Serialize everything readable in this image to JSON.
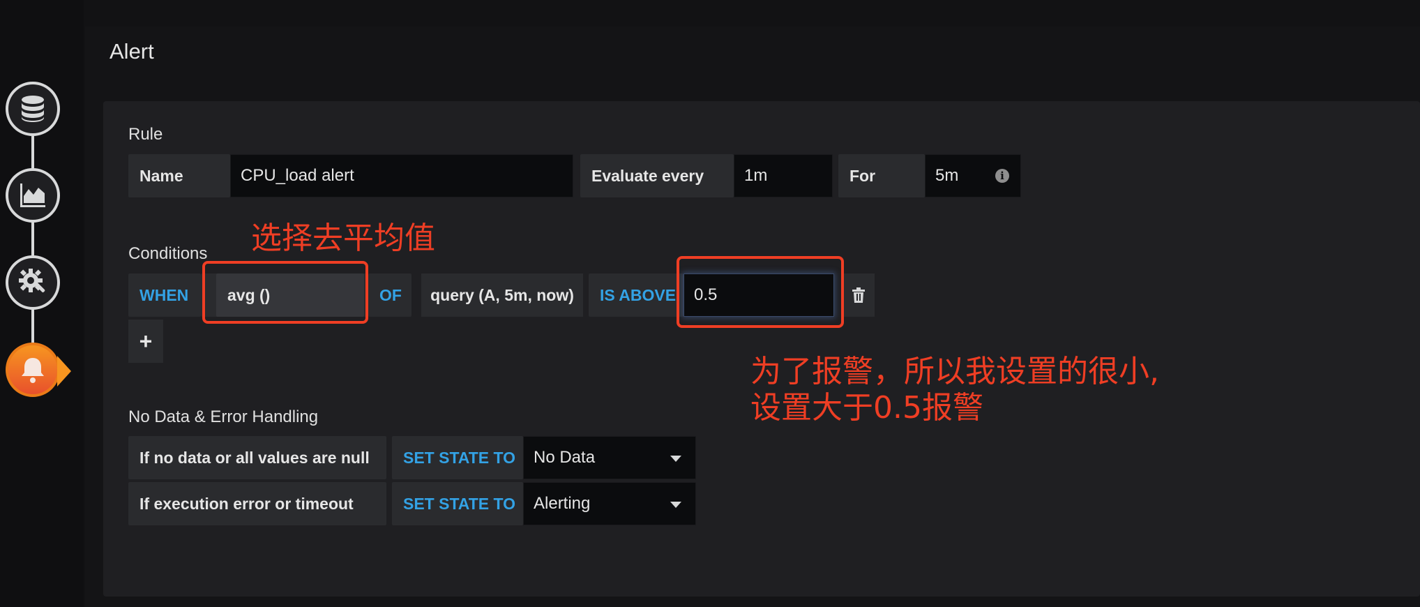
{
  "panel": {
    "title": "Alert"
  },
  "rule": {
    "section_title": "Rule",
    "name_label": "Name",
    "name_value": "CPU_load alert",
    "evaluate_label": "Evaluate every",
    "evaluate_value": "1m",
    "for_label": "For",
    "for_value": "5m"
  },
  "conditions": {
    "section_title": "Conditions",
    "when_label": "WHEN",
    "reducer": "avg ()",
    "of_label": "OF",
    "query": "query (A, 5m, now)",
    "evaluator_label": "IS ABOVE",
    "threshold": "0.5",
    "add_label": "+"
  },
  "no_data": {
    "section_title": "No Data & Error Handling",
    "rows": [
      {
        "condition": "If no data or all values are null",
        "action_label": "SET STATE TO",
        "state": "No Data"
      },
      {
        "condition": "If execution error or timeout",
        "action_label": "SET STATE TO",
        "state": "Alerting"
      }
    ]
  },
  "annotations": {
    "reducer_note": "选择去平均值",
    "threshold_note_line1": "为了报警，所以我设置的很小,",
    "threshold_note_line2": "设置大于0.5报警"
  },
  "icons": {
    "rail": [
      "database-icon",
      "graph-icon",
      "settings-icon",
      "bell-icon"
    ],
    "info": "info-icon",
    "delete": "trash-icon",
    "dropdown": "caret-down-icon"
  },
  "colors": {
    "accent_blue": "#33a2e5",
    "annotation_red": "#ef3e24",
    "active_orange": "#f79520"
  }
}
